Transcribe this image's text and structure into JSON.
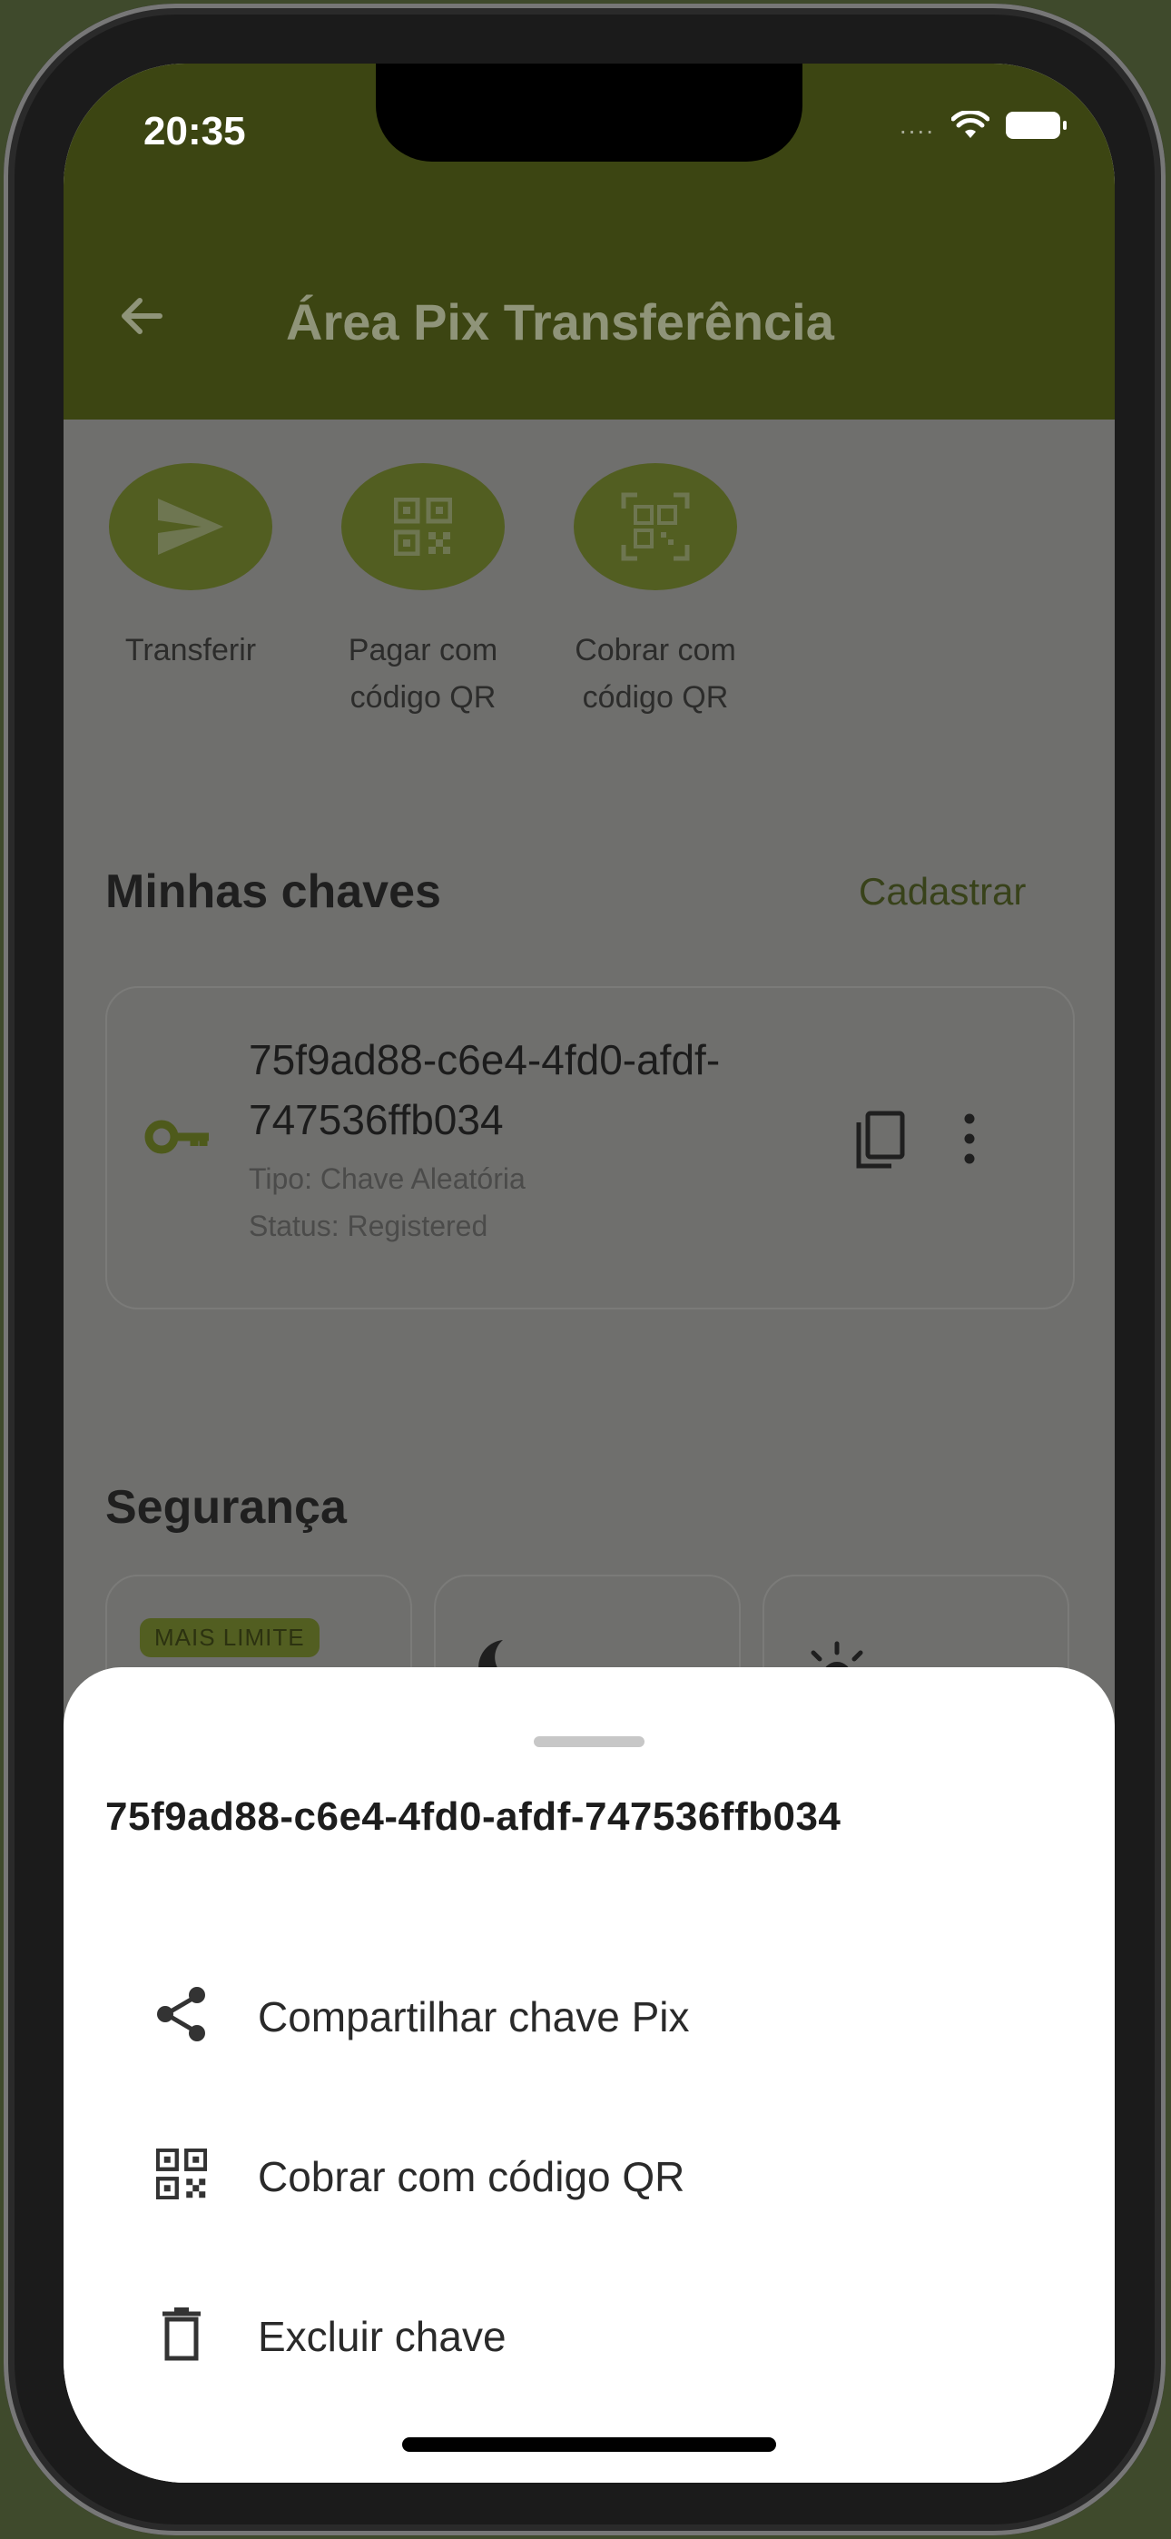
{
  "status_bar": {
    "time": "20:35",
    "signal": "....",
    "wifi_icon": "wifi-icon",
    "battery_icon": "battery-icon"
  },
  "app_bar": {
    "title": "Área Pix Transferência",
    "back_icon": "arrow-left-icon"
  },
  "actions": [
    {
      "label_line1": "Transferir",
      "label_line2": "",
      "icon": "send-icon"
    },
    {
      "label_line1": "Pagar com",
      "label_line2": "código QR",
      "icon": "qr-code-icon"
    },
    {
      "label_line1": "Cobrar com",
      "label_line2": "código QR",
      "icon": "qr-scan-icon"
    }
  ],
  "keys_section": {
    "title": "Minhas chaves",
    "register_link": "Cadastrar",
    "key": {
      "value": "75f9ad88-c6e4-4fd0-afdf-747536ffb034",
      "type": "Tipo: Chave Aleatória",
      "status": "Status: Registered"
    }
  },
  "security_section": {
    "title": "Segurança",
    "badge": "MAIS LIMITE",
    "cards": [
      "shield-icon",
      "moon-icon",
      "sun-icon"
    ]
  },
  "bottom_sheet": {
    "title": "75f9ad88-c6e4-4fd0-afdf-747536ffb034",
    "items": [
      {
        "label": "Compartilhar chave Pix",
        "icon": "share-icon"
      },
      {
        "label": "Cobrar com código QR",
        "icon": "qr-code-icon"
      },
      {
        "label": "Excluir chave",
        "icon": "trash-icon"
      }
    ]
  },
  "colors": {
    "brand_dark": "#3c4512",
    "brand": "#525e21",
    "overlay": "#6f6f6d"
  }
}
